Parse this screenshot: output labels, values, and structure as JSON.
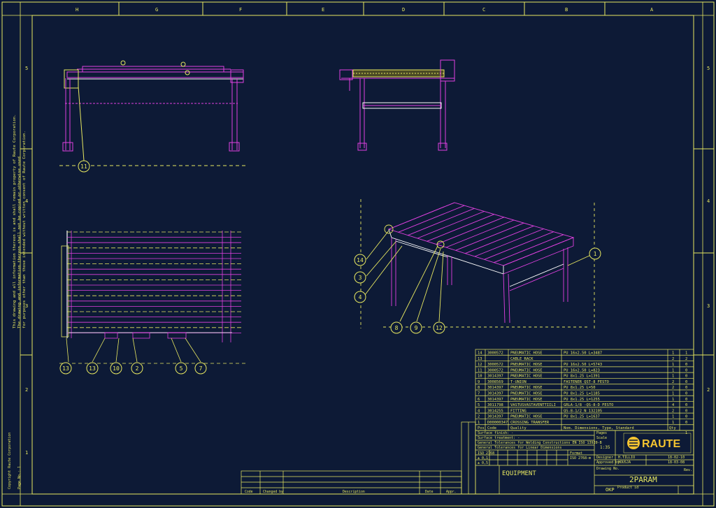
{
  "border": {
    "top_letters": [
      "H",
      "G",
      "F",
      "E",
      "D",
      "C",
      "B",
      "A"
    ],
    "side_numbers": [
      "5",
      "4",
      "3",
      "2",
      "1"
    ]
  },
  "side_note": [
    "This drawing and all information thereon is and shall remain property of Raute Corporation.",
    "The drawing and information thereon shall not be copied or otherwise used",
    "for purposes other than those intended without written consent of Raute Corporation."
  ],
  "side_labels": {
    "small_a": "Copyright Raute Corporation",
    "small_b": "Page No.: 1"
  },
  "balloons": {
    "b11": "11",
    "b14": "14",
    "b3": "3",
    "b4": "4",
    "b8": "8",
    "b9": "9",
    "b12": "12",
    "b1": "1",
    "b13a": "13",
    "b13b": "13",
    "b10": "10",
    "b2": "2",
    "b5": "5",
    "b7": "7"
  },
  "bom": {
    "rows": [
      {
        "pos": "14",
        "code": "3000572",
        "name": "PNEUMATIC HOSE",
        "dim": "PU 16x2.50 L=3487",
        "qty1": "1",
        "qty2": "1"
      },
      {
        "pos": "13",
        "code": "",
        "name": "CABLE RACK",
        "dim": "",
        "qty1": "2",
        "qty2": "2"
      },
      {
        "pos": "12",
        "code": "3000572",
        "name": "PNEUMATIC HOSE",
        "dim": "PU 16x2.50 L=5743",
        "qty1": "1",
        "qty2": "0"
      },
      {
        "pos": "11",
        "code": "3000572",
        "name": "PNEUMATIC HOSE",
        "dim": "PU 16x2.50 L=823",
        "qty1": "1",
        "qty2": "0"
      },
      {
        "pos": "10",
        "code": "3014397",
        "name": "PNEUMATIC HOSE",
        "dim": "PU 8x1.25 L=1391",
        "qty1": "1",
        "qty2": "0"
      },
      {
        "pos": "9",
        "code": "3008569",
        "name": "T-UNION",
        "dim": "FASTENER QST-8 FESTO",
        "qty1": "2",
        "qty2": "0"
      },
      {
        "pos": "8",
        "code": "3014397",
        "name": "PNEUMATIC HOSE",
        "dim": "PU 8x1.25 L=50",
        "qty1": "2",
        "qty2": "0"
      },
      {
        "pos": "7",
        "code": "3014397",
        "name": "PNEUMATIC HOSE",
        "dim": "PU 8x1.25 L=1185",
        "qty1": "1",
        "qty2": "0"
      },
      {
        "pos": "6",
        "code": "3014397",
        "name": "PNEUMATIC HOSE",
        "dim": "PU 8x1.25 L=1255",
        "qty1": "1",
        "qty2": "0"
      },
      {
        "pos": "5",
        "code": "3011798",
        "name": "VASTUSVASTAVENTTIILI",
        "dim": "GRLA-1/8 -QS-8-D FESTO",
        "qty1": "4",
        "qty2": "0"
      },
      {
        "pos": "4",
        "code": "3014255",
        "name": "FITTING",
        "dim": "QS-8-1/2 N 132105",
        "qty1": "2",
        "qty2": "0"
      },
      {
        "pos": "2",
        "code": "3014397",
        "name": "PNEUMATIC HOSE",
        "dim": "PU 8x1.25 L=1637",
        "qty1": "1",
        "qty2": "0"
      },
      {
        "pos": "1",
        "code": "D00000347",
        "name": "CROSSING TRANSFER",
        "dim": "",
        "qty1": "1",
        "qty2": "0"
      }
    ],
    "header": {
      "pos": "Pos",
      "code": "Code",
      "name": "Quality",
      "dim": "Nom. Dimensions, Type, Standard",
      "qty": "Qty"
    }
  },
  "title_block": {
    "finish": "Surface finish: -",
    "treatment": "Surface treatment: -",
    "tol1": "General Tolerances for Welding Constructions EN ISO 13920-B",
    "tol2": "General Tolerances for Linear Dimensions",
    "iso": "ISO 2768-m",
    "tol_a": "ISO 2768",
    "tol_b": "± 0,1",
    "tol_c": "± 0,5",
    "scale_label": "Scale",
    "scale": "1:35",
    "format_label": "Format",
    "format": "A3",
    "pages_label": "Pages",
    "pages": "1",
    "designer_label": "Designer",
    "approved_label": "Approved by",
    "designer": "H.TILLIO",
    "approved": "HOUSJA",
    "date1": "18-02-10",
    "date2": "18-03-08",
    "drawing_no_label": "Drawing No. ",
    "product_label": "Product id",
    "logo": "RAUTE",
    "equipment": "EQUIPMENT",
    "param": "2PARAM",
    "okp": "OKP",
    "rev_label": "Rev."
  },
  "rev_table": {
    "code": "Code",
    "changed_by": "Changed by",
    "description": "Description",
    "date": "Date",
    "approved": "Appr."
  }
}
